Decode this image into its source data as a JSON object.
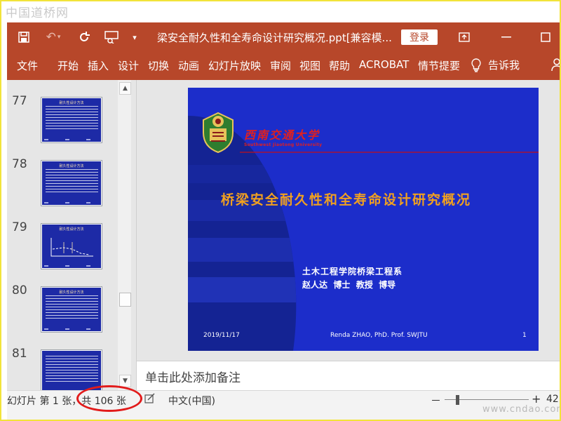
{
  "watermark_top": "中国道桥网",
  "watermark_bottom": "www.cndao.com",
  "titlebar": {
    "document_title": "梁安全耐久性和全寿命设计研究概况.ppt[兼容模...",
    "login_label": "登录"
  },
  "ribbon": {
    "tabs": [
      "文件",
      "开始",
      "插入",
      "设计",
      "切换",
      "动画",
      "幻灯片放映",
      "审阅",
      "视图",
      "帮助",
      "ACROBAT",
      "情节提要"
    ],
    "tell_me": "告诉我"
  },
  "thumbnails": [
    {
      "number": "77",
      "title": "耐久性设计方法"
    },
    {
      "number": "78",
      "title": "耐久性设计方法"
    },
    {
      "number": "79",
      "title": "耐久性设计方法"
    },
    {
      "number": "80",
      "title": "耐久性设计方法"
    },
    {
      "number": "81",
      "title": ""
    }
  ],
  "slide": {
    "university_name_cn": "西南交通大学",
    "university_name_en": "Southwest Jiaotong University",
    "main_title": "桥梁安全耐久性和全寿命设计研究概况",
    "department": "土木工程学院桥梁工程系",
    "author": "赵人达  博士  教授  博导",
    "footer_date": "2019/11/17",
    "footer_author": "Renda ZHAO, PhD. Prof. SWJTU",
    "footer_page": "1"
  },
  "notes_placeholder": "单击此处添加备注",
  "statusbar": {
    "slide_info": "幻灯片 第 1 张，共 106 张",
    "language": "中文(中国)",
    "zoom_minus": "－",
    "zoom_plus": "+",
    "zoom_value": "42"
  },
  "colors": {
    "accent": "#b7472a",
    "slide_bg": "#1c2dca",
    "slide_title": "#f0a020",
    "highlight_circle": "#e21b1b",
    "frame_border": "#f2e33a"
  }
}
